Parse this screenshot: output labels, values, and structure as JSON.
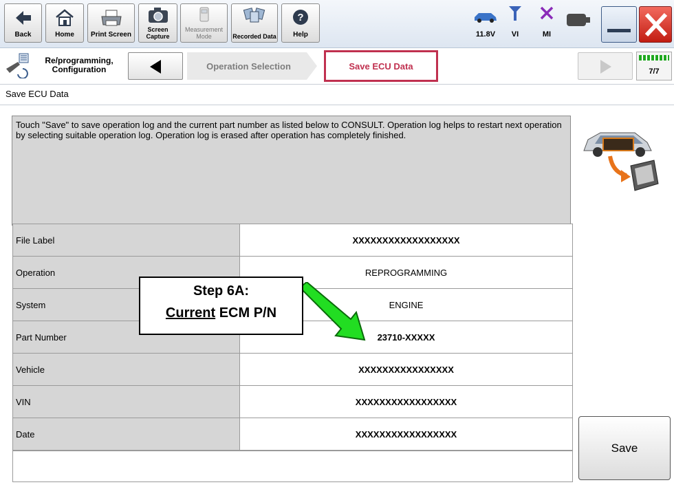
{
  "toolbar": {
    "back": "Back",
    "home": "Home",
    "print_screen": "Print Screen",
    "screen_capture": "Screen Capture",
    "measurement_mode": "Measurement Mode",
    "recorded_data": "Recorded Data",
    "help": "Help",
    "battery_voltage": "11.8V",
    "vi_label": "VI",
    "mi_label": "MI"
  },
  "breadcrumb": {
    "section": "Re/programming, Configuration",
    "step_inactive": "Operation Selection",
    "step_active": "Save ECU Data",
    "progress": "7/7"
  },
  "page_title": "Save ECU Data",
  "message": "Touch \"Save\" to save operation log and the current part number as listed below to CONSULT. Operation log helps to restart next operation by selecting suitable operation log. Operation log is erased after operation has completely finished.",
  "table": [
    {
      "label": "File Label",
      "value": "XXXXXXXXXXXXXXXXXX"
    },
    {
      "label": "Operation",
      "value": "REPROGRAMMING"
    },
    {
      "label": "System",
      "value": "ENGINE"
    },
    {
      "label": "Part Number",
      "value": "23710-XXXXX"
    },
    {
      "label": "Vehicle",
      "value": "XXXXXXXXXXXXXXXX"
    },
    {
      "label": "VIN",
      "value": "XXXXXXXXXXXXXXXXX"
    },
    {
      "label": "Date",
      "value": "XXXXXXXXXXXXXXXXX"
    }
  ],
  "save_label": "Save",
  "callout": {
    "line1": "Step 6A:",
    "line2_underlined": "Current",
    "line2_rest": " ECM P/N"
  },
  "colors": {
    "active_step_border": "#c0304f",
    "arrow_green": "#22dd22",
    "close_red": "#e0241b"
  },
  "icons": [
    "back-arrow-icon",
    "home-icon",
    "printer-icon",
    "camera-icon",
    "measurement-icon",
    "recorded-data-icon",
    "help-icon",
    "car-battery-icon",
    "vi-antenna-icon",
    "mi-cross-icon",
    "connector-icon",
    "minimize-icon",
    "close-icon",
    "reprogramming-icon",
    "car-to-laptop-icon"
  ]
}
